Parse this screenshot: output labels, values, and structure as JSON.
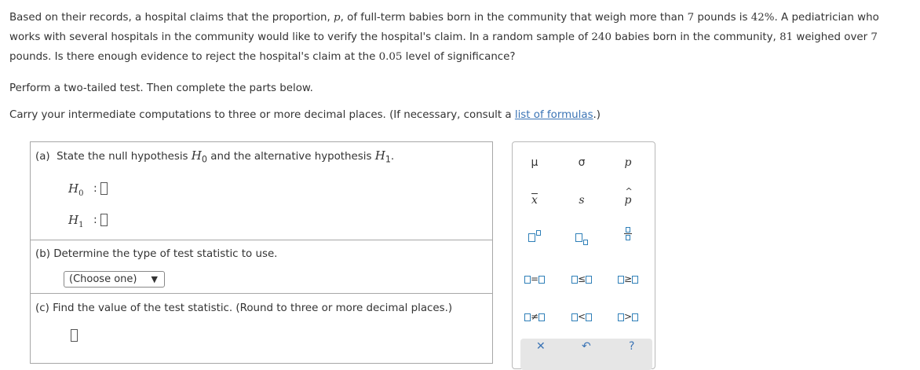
{
  "intro": {
    "t1": "Based on their records, a hospital claims that the proportion, ",
    "p_sym": "p",
    "t2": ", of full-term babies born in the community that weigh more than ",
    "n7a": "7",
    "t3": " pounds is ",
    "pct": "42%",
    "t4": ". A pediatrician who works with several hospitals in the community would like to verify the hospital's claim. In a random sample of ",
    "n240": "240",
    "t5": " babies born in the community, ",
    "n81": "81",
    "t6": " weighed over ",
    "n7b": "7",
    "t7": " pounds. Is there enough evidence to reject the hospital's claim at the ",
    "alpha": "0.05",
    "t8": " level of significance?"
  },
  "instructions": {
    "line1": "Perform a two-tailed test. Then complete the parts below.",
    "line2_before": "Carry your intermediate computations to three or more decimal places. (If necessary, consult a ",
    "link": "list of formulas",
    "line2_after": ".)"
  },
  "part_a": {
    "label": "(a)",
    "text_before": "State the null hypothesis ",
    "h": "H",
    "sub0": "0",
    "text_mid": " and the alternative hypothesis ",
    "sub1": "1",
    "text_end": ".",
    "colon": ":"
  },
  "part_b": {
    "label": "(b)",
    "text": "Determine the type of test statistic to use.",
    "select_value": "(Choose one)"
  },
  "part_c": {
    "label": "(c)",
    "text": "Find the value of the test statistic. (Round to three or more decimal places.)"
  },
  "palette": {
    "mu": "μ",
    "sigma": "σ",
    "p": "p",
    "xbar": "x",
    "s": "s",
    "phat": "p",
    "eq": "=",
    "le": "≤",
    "ge": "≥",
    "ne": "≠",
    "lt": "<",
    "gt": ">"
  },
  "accent_color": "#2e7fb8",
  "link_color": "#3b74b5"
}
